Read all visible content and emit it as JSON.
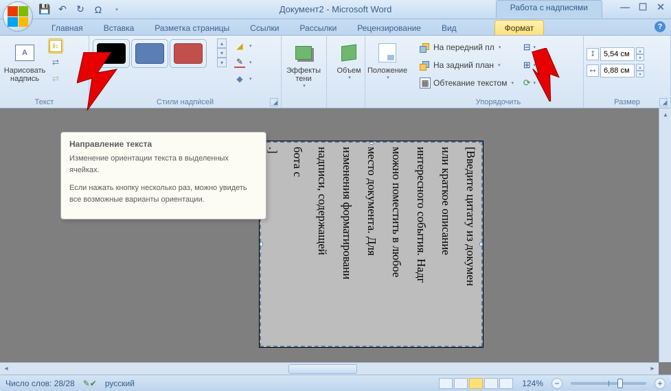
{
  "title": "Документ2 - Microsoft Word",
  "context_tab_group": "Работа с надписями",
  "tabs": {
    "home": "Главная",
    "insert": "Вставка",
    "layout": "Разметка страницы",
    "refs": "Ссылки",
    "mail": "Рассылки",
    "review": "Рецензирование",
    "view": "Вид",
    "format": "Формат"
  },
  "ribbon": {
    "text_group": "Текст",
    "draw_textbox": "Нарисовать надпись",
    "styles_group": "Стили надпи́сей",
    "effects": "Эффекты тени",
    "volume": "Объем",
    "position": "Положение",
    "bring_front": "На передний пл",
    "send_back": "На задний план",
    "wrap": "Обтекание текстом",
    "arrange_group": "Упорядочить",
    "size_group": "Размер",
    "height": "5,54 см",
    "width": "6,88 см",
    "swatches": [
      {
        "fill": "#000000",
        "stroke": "#000000"
      },
      {
        "fill": "#5b7fb4",
        "stroke": "#3a5a8a"
      },
      {
        "fill": "#c1504d",
        "stroke": "#9a3a38"
      }
    ]
  },
  "tooltip": {
    "title": "Направление текста",
    "p1": "Изменение ориентации текста в выделенных ячейках.",
    "p2": "Если нажать кнопку несколько раз, можно увидеть все возможные варианты ориентации."
  },
  "doc": {
    "lines": [
      "[Введите цитату из докумен",
      "или краткое описание",
      "интересного события. Надг",
      "можно поместить в любое",
      "место документа. Для",
      "изменения форматировани",
      "надписи, содержащей",
      "бота с",
      ".]"
    ]
  },
  "status": {
    "words": "Число слов: 28/28",
    "lang": "русский",
    "zoom": "124%"
  }
}
